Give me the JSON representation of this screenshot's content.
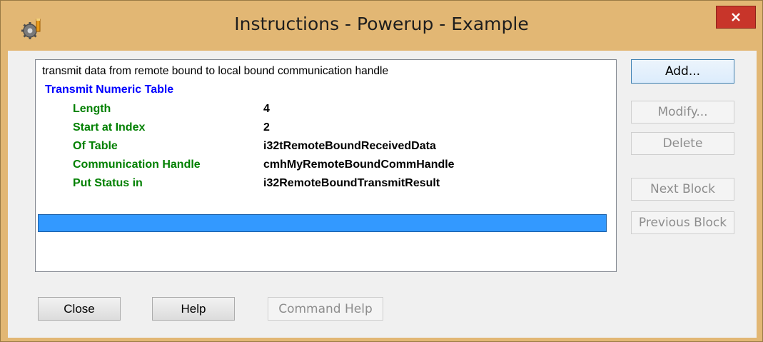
{
  "window": {
    "title": "Instructions - Powerup - Example",
    "close_glyph": "✕"
  },
  "list": {
    "description": "transmit data from remote bound to local bound communication handle",
    "command": "Transmit Numeric Table",
    "params": [
      {
        "name": "Length",
        "value": "4"
      },
      {
        "name": "Start at Index",
        "value": "2"
      },
      {
        "name": "Of Table",
        "value": "i32tRemoteBoundReceivedData"
      },
      {
        "name": "Communication Handle",
        "value": "cmhMyRemoteBoundCommHandle"
      },
      {
        "name": "Put Status in",
        "value": "i32RemoteBoundTransmitResult"
      }
    ]
  },
  "buttons": {
    "add": "Add...",
    "modify": "Modify...",
    "delete": "Delete",
    "next_block": "Next Block",
    "previous_block": "Previous Block",
    "close": "Close",
    "help": "Help",
    "command_help": "Command Help"
  },
  "icons": {
    "app": "app-gear-icon",
    "close": "close-icon"
  },
  "colors": {
    "command": "#0000ff",
    "param_name": "#008000",
    "selection": "#3399ff",
    "close_button": "#c8352a",
    "frame": "#e2b774"
  }
}
